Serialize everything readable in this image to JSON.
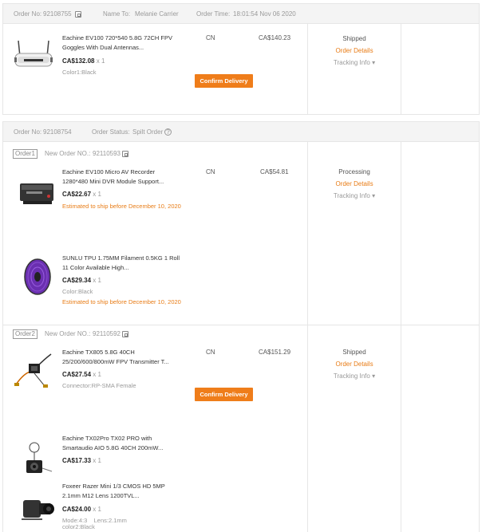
{
  "order1": {
    "no_label": "Order No:",
    "no_value": "92108755",
    "name_label": "Name To:",
    "name_value": "Melanie Carrier",
    "time_label": "Order Time:",
    "time_value": "18:01:54 Nov 06 2020",
    "item": {
      "title": "Eachine EV100 720*540 5.8G 72CH FPV Goggles With Dual Antennas...",
      "price": "CA$132.08",
      "qty": "x 1",
      "attr": "Color1:Black",
      "country": "CN",
      "total": "CA$140.23"
    },
    "confirm_label": "Confirm Delivery",
    "status": "Shipped",
    "details_label": "Order Details",
    "tracking_label": "Tracking Info ▾"
  },
  "order2": {
    "no_label": "Order No:",
    "no_value": "92108754",
    "status_label": "Order Status:",
    "status_value": "Spilt Order",
    "sub1": {
      "badge": "Order1",
      "new_label": "New Order NO.:",
      "new_value": "92110593",
      "country": "CN",
      "total": "CA$54.81",
      "status": "Processing",
      "details_label": "Order Details",
      "tracking_label": "Tracking Info ▾",
      "items": [
        {
          "title": "Eachine EV100 Micro AV Recorder 1280*480 Mini DVR Module Support...",
          "price": "CA$22.67",
          "qty": "x 1",
          "ship": "Estimated to ship before December 10, 2020"
        },
        {
          "title": "SUNLU TPU 1.75MM Filament 0.5KG 1 Roll 11 Color Available High...",
          "price": "CA$29.34",
          "qty": "x 1",
          "attr": "Color:Black",
          "ship": "Estimated to ship before December 10, 2020"
        }
      ]
    },
    "sub2": {
      "badge": "Order2",
      "new_label": "New Order NO.:",
      "new_value": "92110592",
      "country": "CN",
      "total": "CA$151.29",
      "status": "Shipped",
      "details_label": "Order Details",
      "tracking_label": "Tracking Info ▾",
      "confirm_label": "Confirm Delivery",
      "items": [
        {
          "title": "Eachine TX805 5.8G 40CH 25/200/600/800mW FPV Transmitter T...",
          "price": "CA$27.54",
          "qty": "x 1",
          "attr": "Connector:RP-SMA Female"
        },
        {
          "title": "Eachine TX02Pro TX02 PRO with Smartaudio AIO 5.8G 40CH 200mW...",
          "price": "CA$17.33",
          "qty": "x 1"
        },
        {
          "title": "Foxeer Razer Mini 1/3 CMOS HD 5MP 2.1mm M12 Lens 1200TVL...",
          "price": "CA$24.00",
          "qty": "x 1",
          "attr1": "Mode:4:3",
          "attr2": "Lens:2.1mm",
          "attr3": "color2:Black"
        }
      ]
    }
  },
  "colors": {
    "accent": "#ef7d1a",
    "link": "#e87c16",
    "border": "#e6e6e6",
    "header_bg": "#f4f4f4"
  },
  "icons": [
    "copy-icon",
    "help-icon",
    "chevron-down-icon"
  ]
}
